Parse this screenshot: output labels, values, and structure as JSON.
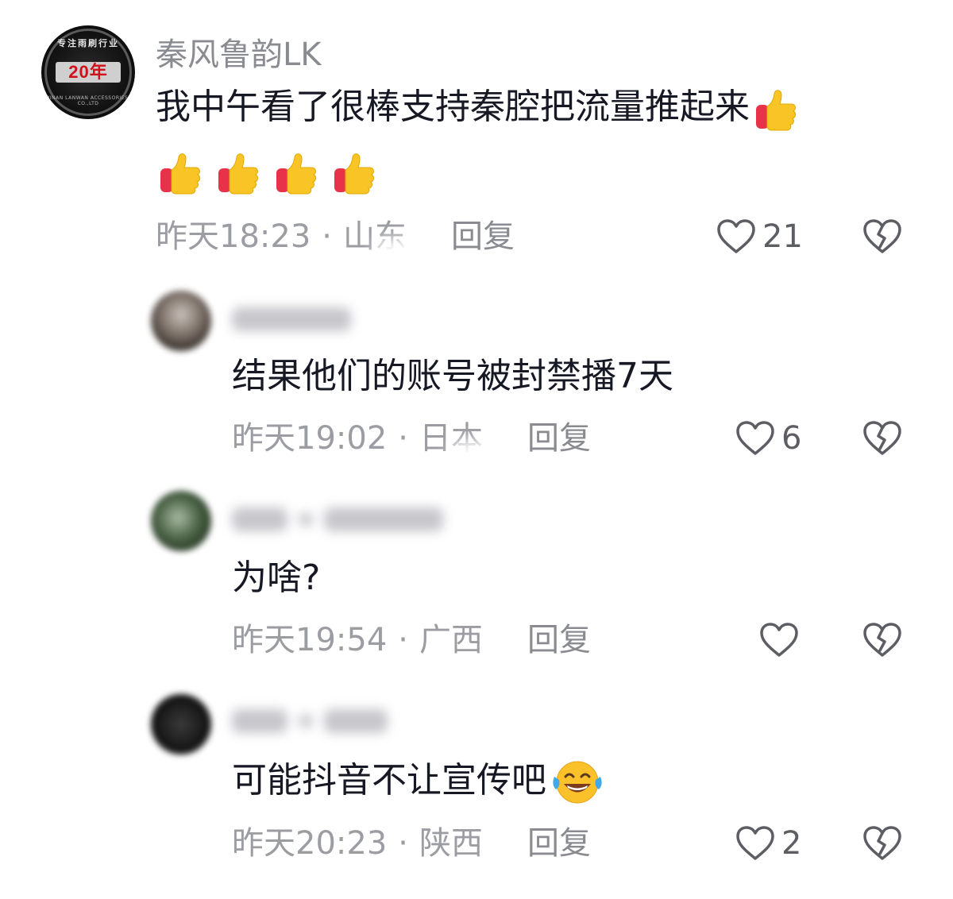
{
  "comments": [
    {
      "username": "秦风鲁韵LK",
      "avatar_badge": "20年",
      "avatar_arc_text": "专注雨刷行业",
      "avatar_bottom_text": "JINAN LANWAN ACCESSORIES CO.,LTD",
      "text": "我中午看了很棒支持秦腔把流量推起来",
      "time": "昨天18:23",
      "separator": "·",
      "location": "山东",
      "reply_label": "回复",
      "likes": "21",
      "trailing_emoji": "thumbs-up",
      "extra_emoji_count": 4
    },
    {
      "text": "结果他们的账号被封禁播7天",
      "time": "昨天19:02",
      "separator": "·",
      "location": "日本",
      "reply_label": "回复",
      "likes": "6"
    },
    {
      "text": "为啥?",
      "time": "昨天19:54",
      "separator": "·",
      "location": "广西",
      "reply_label": "回复",
      "likes": ""
    },
    {
      "text": "可能抖音不让宣传吧",
      "time": "昨天20:23",
      "separator": "·",
      "location": "陕西",
      "reply_label": "回复",
      "likes": "2",
      "trailing_emoji": "tears-of-joy"
    }
  ],
  "icons": {
    "like": "heart-outline-icon",
    "dislike": "broken-heart-icon"
  },
  "colors": {
    "text_primary": "#161823",
    "text_secondary": "#9c9da3",
    "thumb_yellow": "#f9c426",
    "thumb_red": "#e8324a"
  }
}
